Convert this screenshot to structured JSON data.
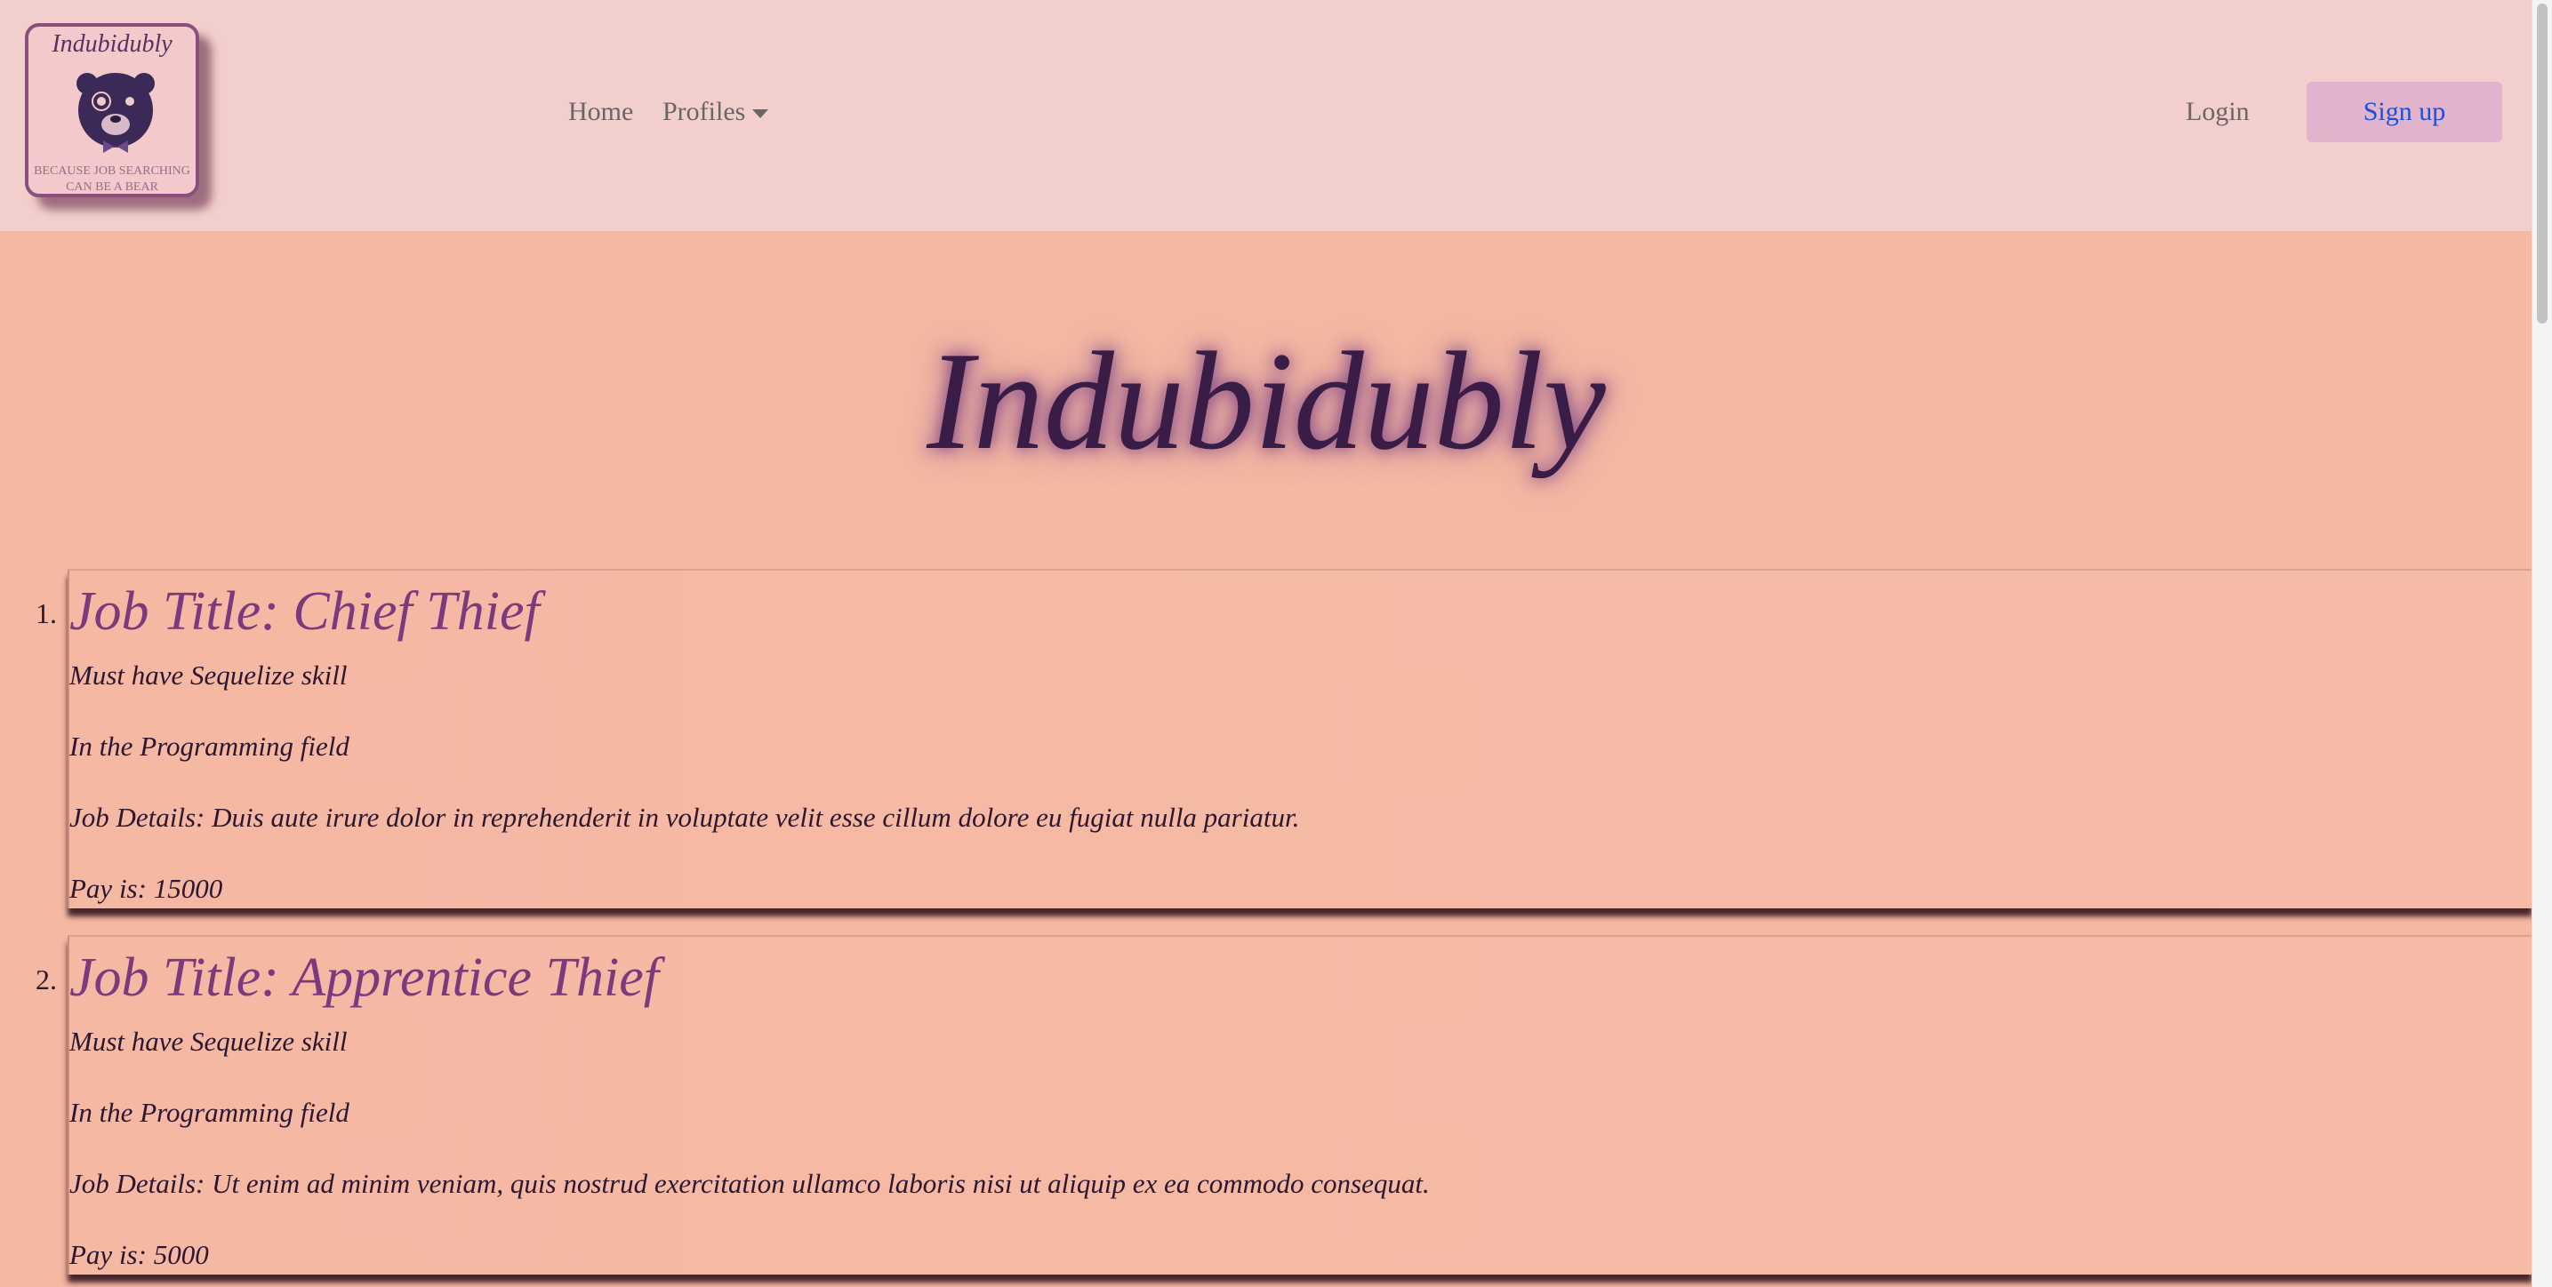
{
  "nav": {
    "logo": {
      "script_text": "Indubidubly",
      "tagline": "Because job searching can be a bear"
    },
    "home_label": "Home",
    "profiles_label": "Profiles",
    "login_label": "Login",
    "signup_label": "Sign up"
  },
  "hero": {
    "title": "Indubidubly"
  },
  "jobs": [
    {
      "number": "1.",
      "title": "Job Title: Chief Thief",
      "skill": "Must have Sequelize skill",
      "field": "In the Programming field",
      "details": "Job Details: Duis aute irure dolor in reprehenderit in voluptate velit esse cillum dolore eu fugiat nulla pariatur.",
      "pay": "Pay is: 15000"
    },
    {
      "number": "2.",
      "title": "Job Title: Apprentice Thief",
      "skill": "Must have Sequelize skill",
      "field": "In the Programming field",
      "details": "Job Details: Ut enim ad minim veniam, quis nostrud exercitation ullamco laboris nisi ut aliquip ex ea commodo consequat.",
      "pay": "Pay is: 5000"
    }
  ],
  "colors": {
    "navbar_bg": "#f2cfcc",
    "page_bg": "#f5b8a3",
    "hero_text": "#3a1d47",
    "job_title": "#7a3a7d",
    "signup_bg": "#e1b3cd",
    "signup_text": "#1d4fd8"
  }
}
